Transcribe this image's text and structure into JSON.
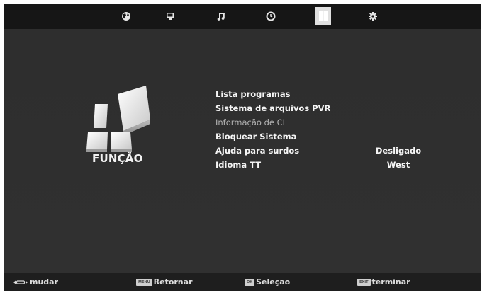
{
  "tabs": [
    {
      "icon": "globe-icon"
    },
    {
      "icon": "monitor-icon"
    },
    {
      "icon": "music-note-icon"
    },
    {
      "icon": "clock-icon"
    },
    {
      "icon": "function-tiles-icon",
      "active": true
    },
    {
      "icon": "gear-icon"
    }
  ],
  "page": {
    "title": "FUNÇÃO",
    "icon": "function-tiles-icon"
  },
  "menu": {
    "items": [
      {
        "label": "Lista programas",
        "value": "",
        "enabled": true
      },
      {
        "label": "Sistema de arquivos PVR",
        "value": "",
        "enabled": true
      },
      {
        "label": "Informação de CI",
        "value": "",
        "enabled": false
      },
      {
        "label": "Bloquear Sistema",
        "value": "",
        "enabled": true
      },
      {
        "label": "Ajuda para surdos",
        "value": "Desligado",
        "enabled": true
      },
      {
        "label": "Idioma TT",
        "value": "West",
        "enabled": true
      }
    ]
  },
  "footer": {
    "change": {
      "icon": "left-right-arrows-icon",
      "label": "mudar"
    },
    "back": {
      "key": "MENU",
      "label": "Retornar"
    },
    "select": {
      "key": "OK",
      "label": "Seleção"
    },
    "exit": {
      "key": "EXIT",
      "label": "terminar"
    }
  },
  "colors": {
    "background": "#2c2c2c",
    "topbar": "#161616",
    "footer": "#1e1e1e",
    "text": "#f4f4f4",
    "disabled_text": "#b4b4b4"
  }
}
